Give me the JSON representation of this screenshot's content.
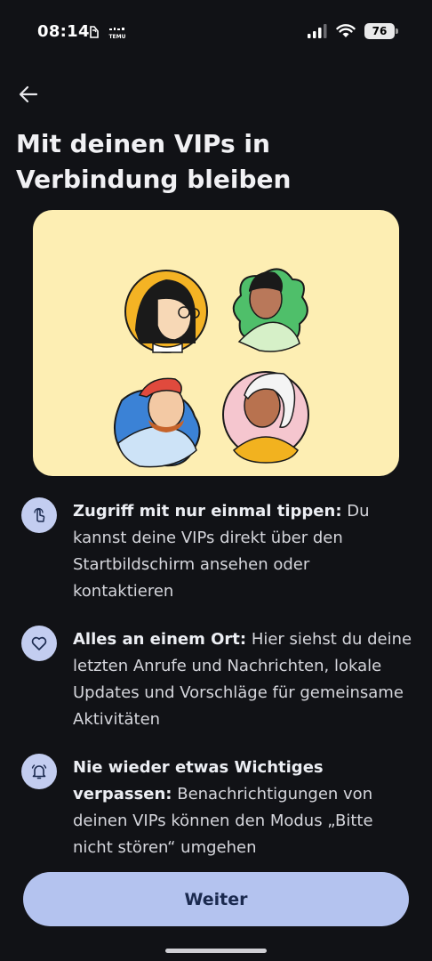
{
  "status_bar": {
    "time": "08:14",
    "battery": "76",
    "app_icons": [
      "notification-icon",
      "temu-app-icon"
    ],
    "temu_label": "TEMU"
  },
  "header": {
    "back_icon": "arrow-back-icon",
    "title": "Mit deinen VIPs in Verbindung bleiben"
  },
  "illustration": {
    "background_color": "#fdeeb3",
    "avatars": [
      "avatar-woman-glasses",
      "avatar-man-green-shirt",
      "avatar-man-red-cap",
      "avatar-elderly-woman"
    ]
  },
  "features": [
    {
      "icon": "tap-icon",
      "title": "Zugriff mit nur einmal tippen:",
      "text": " Du kannst deine VIPs direkt über den Startbildschirm ansehen oder kontaktieren"
    },
    {
      "icon": "heart-icon",
      "title": "Alles an einem Ort:",
      "text": " Hier siehst du deine letzten Anrufe und Nachrichten, lokale Updates und Vorschläge für gemeinsame Aktivitäten"
    },
    {
      "icon": "bell-icon",
      "title": "Nie wieder etwas Wichtiges verpassen:",
      "text": " Benachrichtigungen von deinen VIPs können den Modus „Bitte nicht stören“ umgehen"
    }
  ],
  "footer": {
    "continue_label": "Weiter"
  },
  "colors": {
    "background": "#111216",
    "accent": "#b4c3ef",
    "icon_circle": "#c3cdf0"
  }
}
